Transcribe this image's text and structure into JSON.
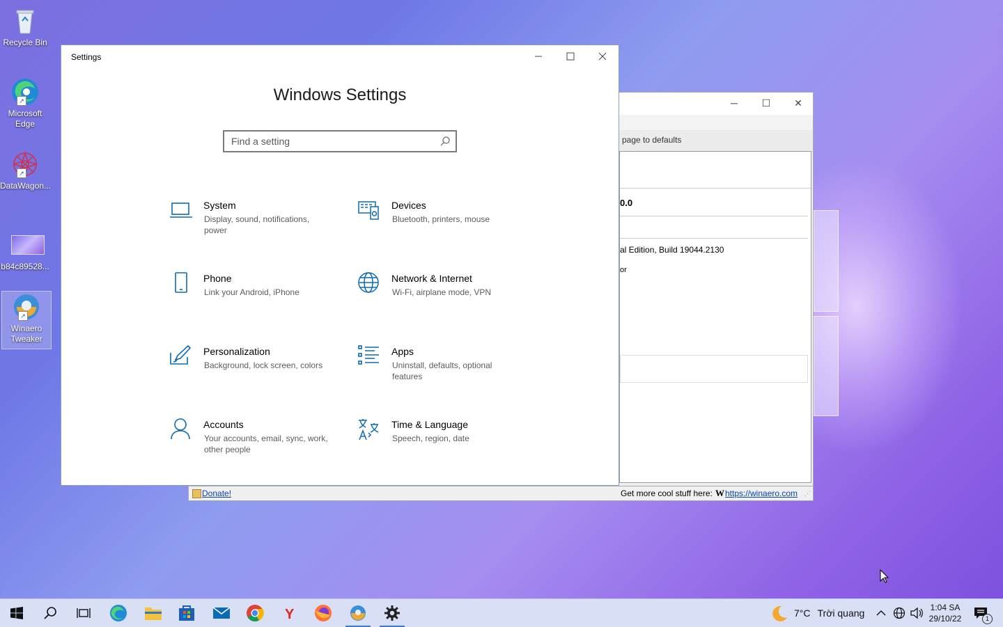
{
  "desktop": {
    "icons": [
      {
        "label": "Recycle Bin"
      },
      {
        "label": "Microsoft Edge"
      },
      {
        "label": "DataWagon..."
      },
      {
        "label": "b84c89528..."
      },
      {
        "label": "Winaero Tweaker"
      }
    ]
  },
  "settings_window": {
    "title": "Settings",
    "heading": "Windows Settings",
    "search_placeholder": "Find a setting",
    "categories": [
      {
        "name": "System",
        "desc": "Display, sound, notifications, power",
        "icon": "laptop-icon"
      },
      {
        "name": "Devices",
        "desc": "Bluetooth, printers, mouse",
        "icon": "devices-icon"
      },
      {
        "name": "Phone",
        "desc": "Link your Android, iPhone",
        "icon": "phone-icon"
      },
      {
        "name": "Network & Internet",
        "desc": "Wi-Fi, airplane mode, VPN",
        "icon": "globe-icon"
      },
      {
        "name": "Personalization",
        "desc": "Background, lock screen, colors",
        "icon": "paintbrush-icon"
      },
      {
        "name": "Apps",
        "desc": "Uninstall, defaults, optional features",
        "icon": "apps-list-icon"
      },
      {
        "name": "Accounts",
        "desc": "Your accounts, email, sync, work, other people",
        "icon": "person-icon"
      },
      {
        "name": "Time & Language",
        "desc": "Speech, region, date",
        "icon": "time-language-icon"
      }
    ]
  },
  "winaero_window": {
    "reset_text": "page to defaults",
    "version_fragment": "0.0",
    "edition_fragment": "al Edition, Build 19044.2130",
    "small_fragment": "or",
    "donate_label": "Donate!",
    "footer_text": "Get more cool stuff here:",
    "footer_link": "https://winaero.com"
  },
  "taskbar": {
    "weather_temp": "7°C",
    "weather_text": "Trời quang",
    "time": "1:04 SA",
    "date": "29/10/22",
    "notification_count": "1"
  },
  "colors": {
    "accent": "#0a6ab6",
    "icon_blue": "#0067b8"
  }
}
